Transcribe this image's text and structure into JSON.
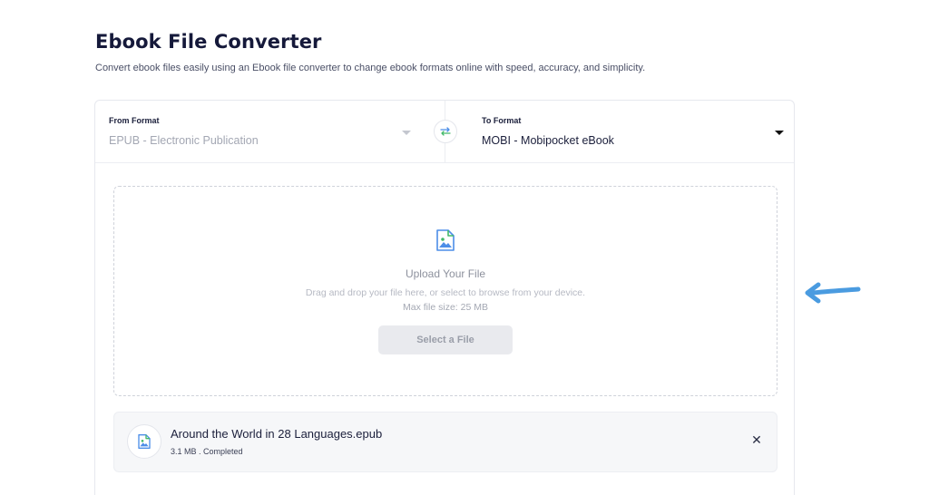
{
  "header": {
    "title": "Ebook File Converter",
    "subtitle": "Convert ebook files easily using an Ebook file converter to change ebook formats online with speed, accuracy, and simplicity."
  },
  "formats": {
    "from": {
      "label": "From Format",
      "value": "EPUB - Electronic Publication"
    },
    "to": {
      "label": "To Format",
      "value": "MOBI - Mobipocket eBook"
    }
  },
  "upload": {
    "title": "Upload Your File",
    "hint": "Drag and drop your file here, or select to browse from your device.",
    "max_size": "Max file size: 25 MB",
    "button_label": "Select a File"
  },
  "file": {
    "name": "Around the World in 28 Languages.epub",
    "meta": "3.1 MB . Completed",
    "close_glyph": "✕"
  },
  "colors": {
    "accent_arrow": "#4a9be0",
    "icon_blue": "#4c8ee8",
    "icon_green": "#43b96a"
  }
}
